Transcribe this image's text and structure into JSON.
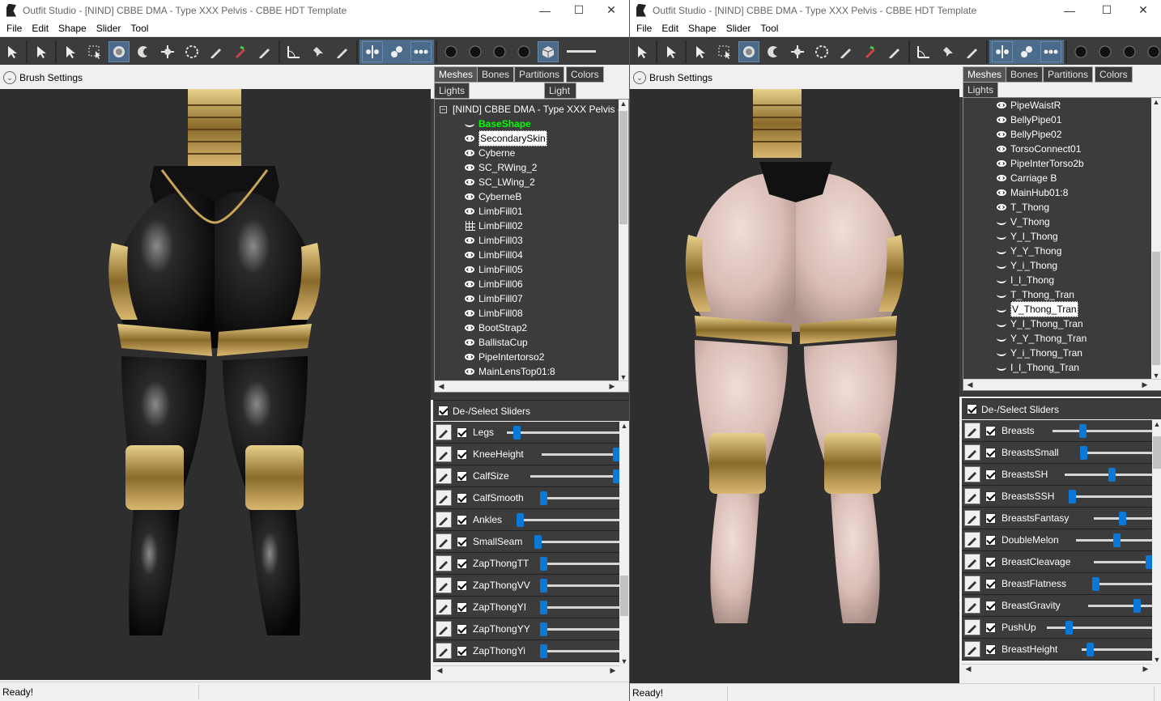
{
  "window1": {
    "title": "Outfit Studio - [NIND] CBBE DMA - Type XXX Pelvis - CBBE HDT Template",
    "menu": [
      "File",
      "Edit",
      "Shape",
      "Slider",
      "Tool"
    ],
    "brush_settings": "Brush Settings",
    "tabs": [
      "Meshes",
      "Bones",
      "Partitions",
      "Colors",
      "Lights",
      "Light"
    ],
    "tree_root": "[NIND] CBBE DMA - Type XXX Pelvis -",
    "meshes": [
      {
        "name": "BaseShape",
        "state": "closed",
        "style": "green"
      },
      {
        "name": "SecondarySkin",
        "state": "eye",
        "style": "selected"
      },
      {
        "name": "Cyberne",
        "state": "eye",
        "style": ""
      },
      {
        "name": "SC_RWing_2",
        "state": "eye",
        "style": ""
      },
      {
        "name": "SC_LWing_2",
        "state": "eye",
        "style": ""
      },
      {
        "name": "CyberneB",
        "state": "eye",
        "style": ""
      },
      {
        "name": "LimbFill01",
        "state": "eye",
        "style": ""
      },
      {
        "name": "LimbFill02",
        "state": "grid",
        "style": ""
      },
      {
        "name": "LimbFill03",
        "state": "eye",
        "style": ""
      },
      {
        "name": "LimbFill04",
        "state": "eye",
        "style": ""
      },
      {
        "name": "LimbFill05",
        "state": "eye",
        "style": ""
      },
      {
        "name": "LimbFill06",
        "state": "eye",
        "style": ""
      },
      {
        "name": "LimbFill07",
        "state": "eye",
        "style": ""
      },
      {
        "name": "LimbFill08",
        "state": "eye",
        "style": ""
      },
      {
        "name": "BootStrap2",
        "state": "eye",
        "style": ""
      },
      {
        "name": "BallistaCup",
        "state": "eye",
        "style": ""
      },
      {
        "name": "PipeIntertorso2",
        "state": "eye",
        "style": ""
      },
      {
        "name": "MainLensTop01:8",
        "state": "eye",
        "style": ""
      }
    ],
    "sliders_header": "De-/Select Sliders",
    "sliders": [
      {
        "name": "Legs",
        "value": 0.08
      },
      {
        "name": "KneeHeight",
        "value": 1.0
      },
      {
        "name": "CalfSize",
        "value": 1.0
      },
      {
        "name": "CalfSmooth",
        "value": 0.0
      },
      {
        "name": "Ankles",
        "value": 0.0
      },
      {
        "name": "SmallSeam",
        "value": 0.0
      },
      {
        "name": "ZapThongTT",
        "value": 0.0
      },
      {
        "name": "ZapThongVV",
        "value": 0.0
      },
      {
        "name": "ZapThongYI",
        "value": 0.0
      },
      {
        "name": "ZapThongYY",
        "value": 0.0
      },
      {
        "name": "ZapThongYi",
        "value": 0.0
      }
    ],
    "status": "Ready!"
  },
  "window2": {
    "title": "Outfit Studio - [NIND] CBBE DMA - Type XXX Pelvis - CBBE HDT Template",
    "menu": [
      "File",
      "Edit",
      "Shape",
      "Slider",
      "Tool"
    ],
    "brush_settings": "Brush Settings",
    "tabs": [
      "Meshes",
      "Bones",
      "Partitions",
      "Colors",
      "Lights"
    ],
    "meshes": [
      {
        "name": "PipeWaistR",
        "state": "eye",
        "style": ""
      },
      {
        "name": "BellyPipe01",
        "state": "eye",
        "style": ""
      },
      {
        "name": "BellyPipe02",
        "state": "eye",
        "style": ""
      },
      {
        "name": "TorsoConnect01",
        "state": "eye",
        "style": ""
      },
      {
        "name": "PipeInterTorso2b",
        "state": "eye",
        "style": ""
      },
      {
        "name": "Carriage B",
        "state": "eye",
        "style": ""
      },
      {
        "name": "MainHub01:8",
        "state": "eye",
        "style": ""
      },
      {
        "name": "T_Thong",
        "state": "eye",
        "style": ""
      },
      {
        "name": "V_Thong",
        "state": "closed",
        "style": ""
      },
      {
        "name": "Y_I_Thong",
        "state": "closed",
        "style": ""
      },
      {
        "name": "Y_Y_Thong",
        "state": "closed",
        "style": ""
      },
      {
        "name": "Y_i_Thong",
        "state": "closed",
        "style": ""
      },
      {
        "name": "I_I_Thong",
        "state": "closed",
        "style": ""
      },
      {
        "name": "T_Thong_Tran",
        "state": "closed",
        "style": ""
      },
      {
        "name": "V_Thong_Tran",
        "state": "closed",
        "style": "selected"
      },
      {
        "name": "Y_I_Thong_Tran",
        "state": "closed",
        "style": ""
      },
      {
        "name": "Y_Y_Thong_Tran",
        "state": "closed",
        "style": ""
      },
      {
        "name": "Y_i_Thong_Tran",
        "state": "closed",
        "style": ""
      },
      {
        "name": "I_I_Thong_Tran",
        "state": "closed",
        "style": ""
      }
    ],
    "sliders_header": "De-/Select Sliders",
    "sliders": [
      {
        "name": "Breasts",
        "value": 0.3
      },
      {
        "name": "BreastsSmall",
        "value": 0.0
      },
      {
        "name": "BreastsSH",
        "value": 0.55
      },
      {
        "name": "BreastsSSH",
        "value": 0.0
      },
      {
        "name": "BreastsFantasy",
        "value": 0.5
      },
      {
        "name": "DoubleMelon",
        "value": 0.55
      },
      {
        "name": "BreastCleavage",
        "value": 1.0
      },
      {
        "name": "BreastFlatness",
        "value": 0.0
      },
      {
        "name": "BreastGravity",
        "value": 0.8
      },
      {
        "name": "PushUp",
        "value": 0.2
      },
      {
        "name": "BreastHeight",
        "value": 0.1
      }
    ],
    "status": "Ready!"
  },
  "colors": {
    "accent": "#0a78d7",
    "panel": "#3c3c3c",
    "viewport": "#2e2e2e",
    "highlight_green": "#00ff00"
  }
}
